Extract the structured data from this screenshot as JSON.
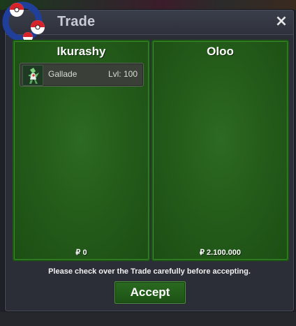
{
  "window": {
    "title": "Trade",
    "close_symbol": "×"
  },
  "icons": {
    "logo": "pokeball-swap-icon",
    "close": "close-icon",
    "pokemon": "gallade-sprite-icon"
  },
  "colors": {
    "panel_green": "#245c1a",
    "button_green": "#1d5216",
    "window_bg": "#2b2e37"
  },
  "left_panel": {
    "player": "Ikurashy",
    "pokemon": [
      {
        "name": "Gallade",
        "level": "Lvl: 100"
      }
    ],
    "money": "₽ 0"
  },
  "right_panel": {
    "player": "Oloo",
    "pokemon": [],
    "money": "₽ 2.100.000"
  },
  "notice": "Please check over the Trade carefully before accepting.",
  "accept_label": "Accept"
}
